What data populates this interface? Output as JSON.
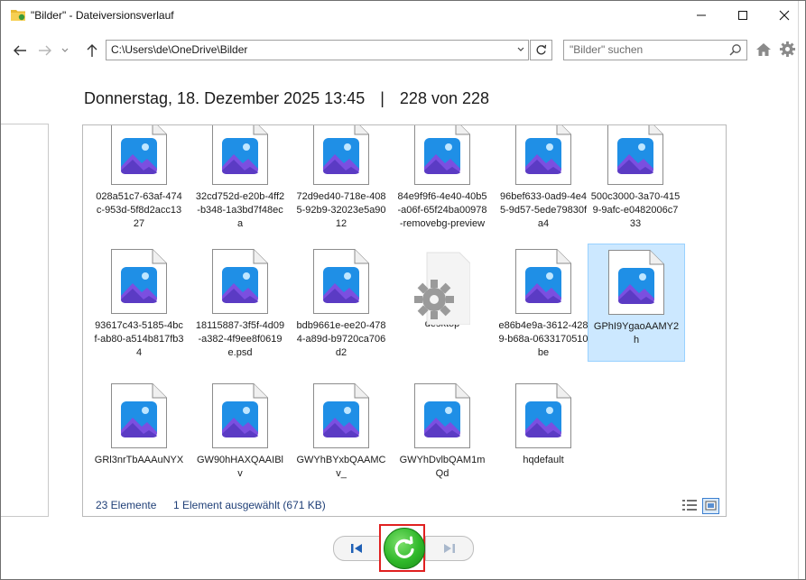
{
  "window": {
    "title": "\"Bilder\" - Dateiversionsverlauf",
    "minimize_label": "minimize",
    "maximize_label": "maximize",
    "close_label": "close"
  },
  "nav": {
    "address": "C:\\Users\\de\\OneDrive\\Bilder",
    "search_placeholder": "\"Bilder\" suchen"
  },
  "heading": {
    "date": "Donnerstag, 18. Dezember 2025 13:45",
    "separator": "|",
    "version": "228 von 228"
  },
  "files": [
    {
      "name": "028a51c7-63af-474c-953d-5f8d2acc1327",
      "type": "image"
    },
    {
      "name": "32cd752d-e20b-4ff2-b348-1a3bd7f48eca",
      "type": "image"
    },
    {
      "name": "72d9ed40-718e-4085-92b9-32023e5a9012",
      "type": "image"
    },
    {
      "name": "84e9f9f6-4e40-40b5-a06f-65f24ba00978-removebg-preview",
      "type": "image"
    },
    {
      "name": "96bef633-0ad9-4e45-9d57-5ede79830fa4",
      "type": "image"
    },
    {
      "name": "500c3000-3a70-4159-9afc-e0482006c733",
      "type": "image"
    },
    {
      "name": "93617c43-5185-4bcf-ab80-a514b817fb34",
      "type": "image"
    },
    {
      "name": "18115887-3f5f-4d09-a382-4f9ee8f0619e.psd",
      "type": "image"
    },
    {
      "name": "bdb9661e-ee20-4784-a89d-b9720ca706d2",
      "type": "image"
    },
    {
      "name": "desktop",
      "type": "settings"
    },
    {
      "name": "e86b4e9a-3612-4289-b68a-0633170510be",
      "type": "image"
    },
    {
      "name": "GPhI9YgaoAAMY2h",
      "type": "image",
      "selected": true
    },
    {
      "name": "GRl3nrTbAAAuNYX",
      "type": "image"
    },
    {
      "name": "GW90hHAXQAAIBlv",
      "type": "image"
    },
    {
      "name": "GWYhBYxbQAAMCv_",
      "type": "image"
    },
    {
      "name": "GWYhDvlbQAM1mQd",
      "type": "image"
    },
    {
      "name": "hqdefault",
      "type": "image"
    }
  ],
  "status": {
    "count": "23 Elemente",
    "selection": "1 Element ausgewählt (671 KB)"
  },
  "icons": {
    "back": "arrow-left-icon",
    "forward": "arrow-right-icon",
    "recent": "chevron-down-icon",
    "up": "arrow-up-icon",
    "refresh": "refresh-icon",
    "search": "search-icon",
    "home": "home-icon",
    "settings": "gear-icon",
    "previous": "previous-version-icon",
    "restore": "restore-icon",
    "next": "next-version-icon"
  },
  "colors": {
    "selection_bg": "#cce8ff",
    "restore_green": "#2fb82a",
    "highlight_frame": "#e02020",
    "status_text": "#1f3f77"
  },
  "footer_text": "..."
}
